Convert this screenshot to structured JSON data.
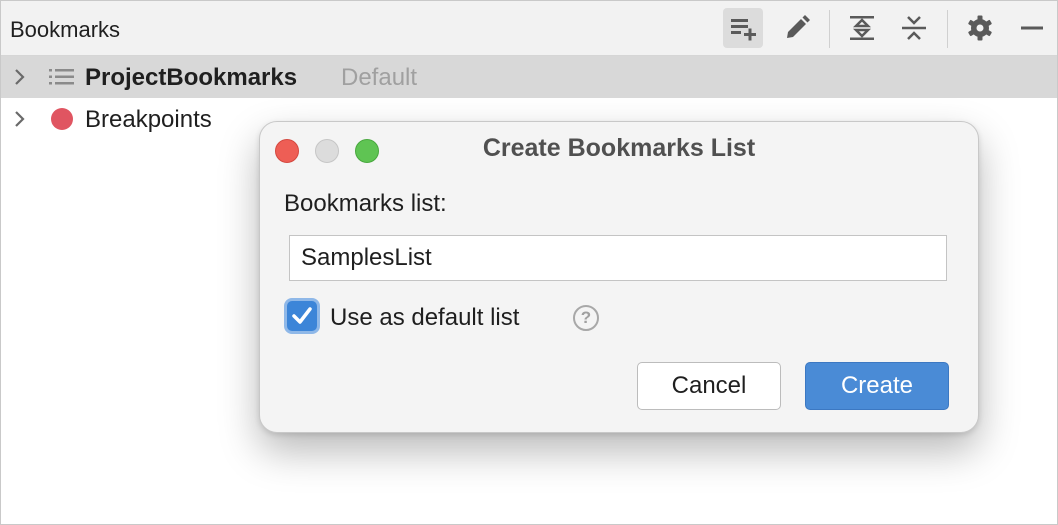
{
  "panel": {
    "title": "Bookmarks",
    "toolbar": {
      "icons": [
        "add-list-icon",
        "edit-icon",
        "expand-all-icon",
        "collapse-all-icon",
        "gear-icon",
        "minimize-icon"
      ]
    }
  },
  "tree": {
    "items": [
      {
        "label": "ProjectBookmarks",
        "hint": "Default",
        "icon": "list-icon",
        "selected": true
      },
      {
        "label": "Breakpoints",
        "icon": "breakpoint-dot-icon",
        "selected": false
      }
    ]
  },
  "dialog": {
    "title": "Create Bookmarks List",
    "field_label": "Bookmarks list:",
    "field_value": "SamplesList",
    "checkbox_label": "Use as default list",
    "checkbox_checked": true,
    "help_glyph": "?",
    "cancel_label": "Cancel",
    "create_label": "Create"
  },
  "colors": {
    "accent": "#4a8bd6",
    "breakpoint": "#e05561",
    "traffic_red": "#ee5e55",
    "traffic_green": "#5fc453"
  }
}
